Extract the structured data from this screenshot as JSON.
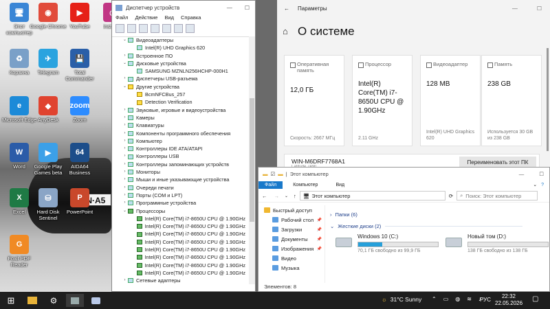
{
  "desktop": {
    "icons": [
      {
        "label": "Этот компьютер",
        "glyph": "🖥",
        "color": "#3a86d6"
      },
      {
        "label": "Google Chrome",
        "glyph": "◉",
        "color": "#e14b3b"
      },
      {
        "label": "YouTube",
        "glyph": "▶",
        "color": "#e62117"
      },
      {
        "label": "Корзина",
        "glyph": "♻",
        "color": "#7aa0c8"
      },
      {
        "label": "Telegram",
        "glyph": "✈",
        "color": "#2aa3df"
      },
      {
        "label": "Total Commander",
        "glyph": "💾",
        "color": "#2a5fa8"
      },
      {
        "label": "Microsoft Edge",
        "glyph": "e",
        "color": "#1c8ad8"
      },
      {
        "label": "AnyDesk",
        "glyph": "◆",
        "color": "#e0432f"
      },
      {
        "label": "Zoom",
        "glyph": "zoom",
        "color": "#2d8cff"
      },
      {
        "label": "Word",
        "glyph": "W",
        "color": "#2b5ca8"
      },
      {
        "label": "Google Play Games beta",
        "glyph": "▶",
        "color": "#3ca0e8"
      },
      {
        "label": "AIDA64 Business",
        "glyph": "64",
        "color": "#1d4e8a"
      },
      {
        "label": "Excel",
        "glyph": "X",
        "color": "#1f7a45"
      },
      {
        "label": "Hard Disk Sentinel",
        "glyph": "⛁",
        "color": "#8aa5c6"
      },
      {
        "label": "PowerPoint",
        "glyph": "P",
        "color": "#c9482b"
      },
      {
        "label": "Foxit PDF Reader",
        "glyph": "G",
        "color": "#f08a24"
      }
    ],
    "partial_icon_label": "Insta",
    "plate_text": "IN·A5"
  },
  "device_manager": {
    "title": "Диспетчер устройств",
    "menu": [
      "Файл",
      "Действие",
      "Вид",
      "Справка"
    ],
    "tree": [
      {
        "text": "Видеоадаптеры",
        "level": 0,
        "state": "expanded",
        "icon": "normal"
      },
      {
        "text": "Intel(R) UHD Graphics 620",
        "level": 1,
        "state": "leaf",
        "icon": "normal"
      },
      {
        "text": "Встроенное ПО",
        "level": 0,
        "state": "collapsed",
        "icon": "normal"
      },
      {
        "text": "Дисковые устройства",
        "level": 0,
        "state": "expanded",
        "icon": "normal"
      },
      {
        "text": "SAMSUNG MZNLN256HCHP-000H1",
        "level": 1,
        "state": "leaf",
        "icon": "normal"
      },
      {
        "text": "Диспетчеры USB-разъема",
        "level": 0,
        "state": "collapsed",
        "icon": "normal"
      },
      {
        "text": "Другие устройства",
        "level": 0,
        "state": "expanded",
        "icon": "warn"
      },
      {
        "text": "BcmNFCBus_257",
        "level": 1,
        "state": "leaf",
        "icon": "warn"
      },
      {
        "text": "Detection Verification",
        "level": 1,
        "state": "leaf",
        "icon": "warn"
      },
      {
        "text": "Звуковые, игровые и видеоустройства",
        "level": 0,
        "state": "collapsed",
        "icon": "normal"
      },
      {
        "text": "Камеры",
        "level": 0,
        "state": "collapsed",
        "icon": "normal"
      },
      {
        "text": "Клавиатуры",
        "level": 0,
        "state": "collapsed",
        "icon": "normal"
      },
      {
        "text": "Компоненты программного обеспечения",
        "level": 0,
        "state": "collapsed",
        "icon": "normal"
      },
      {
        "text": "Компьютер",
        "level": 0,
        "state": "collapsed",
        "icon": "normal"
      },
      {
        "text": "Контроллеры IDE ATA/ATAPI",
        "level": 0,
        "state": "collapsed",
        "icon": "normal"
      },
      {
        "text": "Контроллеры USB",
        "level": 0,
        "state": "collapsed",
        "icon": "normal"
      },
      {
        "text": "Контроллеры запоминающих устройств",
        "level": 0,
        "state": "collapsed",
        "icon": "normal"
      },
      {
        "text": "Мониторы",
        "level": 0,
        "state": "collapsed",
        "icon": "normal"
      },
      {
        "text": "Мыши и иные указывающие устройства",
        "level": 0,
        "state": "collapsed",
        "icon": "normal"
      },
      {
        "text": "Очереди печати",
        "level": 0,
        "state": "collapsed",
        "icon": "normal"
      },
      {
        "text": "Порты (COM и LPT)",
        "level": 0,
        "state": "collapsed",
        "icon": "normal"
      },
      {
        "text": "Программные устройства",
        "level": 0,
        "state": "collapsed",
        "icon": "normal"
      },
      {
        "text": "Процессоры",
        "level": 0,
        "state": "expanded",
        "icon": "cpu"
      },
      {
        "text": "Intel(R) Core(TM) i7-8650U CPU @ 1.90GHz",
        "level": 1,
        "state": "leaf",
        "icon": "cpu"
      },
      {
        "text": "Intel(R) Core(TM) i7-8650U CPU @ 1.90GHz",
        "level": 1,
        "state": "leaf",
        "icon": "cpu"
      },
      {
        "text": "Intel(R) Core(TM) i7-8650U CPU @ 1.90GHz",
        "level": 1,
        "state": "leaf",
        "icon": "cpu"
      },
      {
        "text": "Intel(R) Core(TM) i7-8650U CPU @ 1.90GHz",
        "level": 1,
        "state": "leaf",
        "icon": "cpu"
      },
      {
        "text": "Intel(R) Core(TM) i7-8650U CPU @ 1.90GHz",
        "level": 1,
        "state": "leaf",
        "icon": "cpu"
      },
      {
        "text": "Intel(R) Core(TM) i7-8650U CPU @ 1.90GHz",
        "level": 1,
        "state": "leaf",
        "icon": "cpu"
      },
      {
        "text": "Intel(R) Core(TM) i7-8650U CPU @ 1.90GHz",
        "level": 1,
        "state": "leaf",
        "icon": "cpu"
      },
      {
        "text": "Intel(R) Core(TM) i7-8650U CPU @ 1.90GHz",
        "level": 1,
        "state": "leaf",
        "icon": "cpu"
      },
      {
        "text": "Сетевые адаптеры",
        "level": 0,
        "state": "collapsed",
        "icon": "normal"
      }
    ]
  },
  "settings": {
    "window_title": "Параметры",
    "page_title": "О системе",
    "cards": [
      {
        "label": "Оперативная память",
        "value": "12,0 ГБ",
        "sub": "Скорость: 2667 МГц"
      },
      {
        "label": "Процессор",
        "value": "Intel(R) Core(TM) i7-8650U CPU @ 1.90GHz",
        "sub": "2.11 GHz"
      },
      {
        "label": "Видеоадаптер",
        "value": "128 MB",
        "sub": "Intel(R) UHD Graphics 620"
      },
      {
        "label": "Память",
        "value": "238 GB",
        "sub": "Используется 30 GB из 238 GB"
      }
    ],
    "pc_name": "WIN-M6DRF7768A1",
    "pc_model": "Latitude 7490",
    "rename_button": "Переименовать этот ПК"
  },
  "explorer": {
    "title": "Этот компьютер",
    "ribbon_tabs": [
      "Файл",
      "Компьютер",
      "Вид"
    ],
    "address": "Этот компьютер",
    "search_placeholder": "Поиск: Этот компьютер",
    "nav": [
      "Быстрый доступ",
      "Рабочий стол",
      "Загрузки",
      "Документы",
      "Изображения",
      "Видео",
      "Музыка"
    ],
    "folders_header": "Папки (6)",
    "drives_header": "Жесткие диски (2)",
    "drives": [
      {
        "name": "Windows 10 (C:)",
        "free": "70,1 ГБ свободно из 99,9 ГБ",
        "used_fraction": 0.3
      },
      {
        "name": "Новый том (D:)",
        "free": "138 ГБ свободно из 138 ГБ",
        "used_fraction": 0.0
      }
    ],
    "status": "Элементов: 8"
  },
  "taskbar": {
    "weather": "31°C  Sunny",
    "language": "РУС",
    "time": "22:32",
    "date": "22.05.2026"
  }
}
